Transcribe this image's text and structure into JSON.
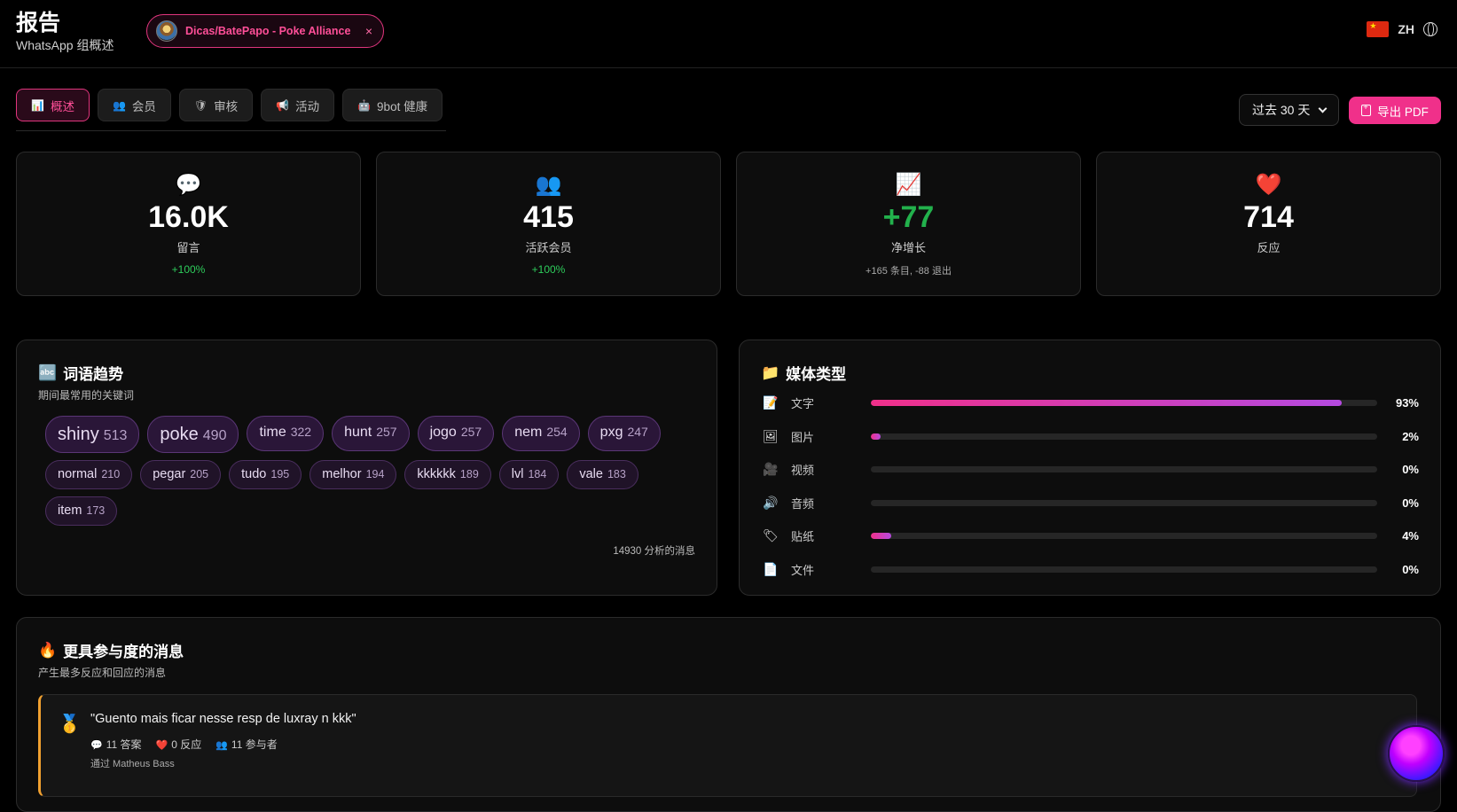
{
  "header": {
    "title": "报告",
    "subtitle": "WhatsApp 组概述",
    "group_name": "Dicas/BatePapo - Poke Alliance",
    "close_glyph": "×",
    "lang_code": "ZH"
  },
  "tabs": [
    {
      "icon": "📊",
      "label": "概述",
      "active": true
    },
    {
      "icon": "👥",
      "label": "会员"
    },
    {
      "icon": "🛡",
      "label": "审核"
    },
    {
      "icon": "📢",
      "label": "活动"
    },
    {
      "icon": "🤖",
      "label": "9bot 健康"
    }
  ],
  "controls": {
    "range": "过去 30 天",
    "export_label": "导出 PDF"
  },
  "stats": [
    {
      "icon": "💬",
      "value": "16.0K",
      "label": "留言",
      "delta": "+100%"
    },
    {
      "icon": "👥",
      "value": "415",
      "label": "活跃会员",
      "delta": "+100%"
    },
    {
      "icon": "📈",
      "value": "+77",
      "label": "净增长",
      "delta": "+165 条目, -88 退出"
    },
    {
      "icon": "❤️",
      "value": "714",
      "label": "反应",
      "delta": ""
    }
  ],
  "words_panel": {
    "icon": "🔤",
    "title": "词语趋势",
    "subtitle": "期间最常用的关键词",
    "words": [
      {
        "word": "shiny",
        "count": "513"
      },
      {
        "word": "poke",
        "count": "490"
      },
      {
        "word": "time",
        "count": "322"
      },
      {
        "word": "hunt",
        "count": "257"
      },
      {
        "word": "jogo",
        "count": "257"
      },
      {
        "word": "nem",
        "count": "254"
      },
      {
        "word": "pxg",
        "count": "247"
      },
      {
        "word": "normal",
        "count": "210"
      },
      {
        "word": "pegar",
        "count": "205"
      },
      {
        "word": "tudo",
        "count": "195"
      },
      {
        "word": "melhor",
        "count": "194"
      },
      {
        "word": "kkkkkk",
        "count": "189"
      },
      {
        "word": "lvl",
        "count": "184"
      },
      {
        "word": "vale",
        "count": "183"
      },
      {
        "word": "item",
        "count": "173"
      }
    ],
    "analyzed": "14930 分析的消息"
  },
  "media_panel": {
    "icon": "📁",
    "title": "媒体类型",
    "rows": [
      {
        "icon": "📝",
        "label": "文字",
        "pct": "93%",
        "value": 93
      },
      {
        "icon": "🖼",
        "label": "图片",
        "pct": "2%",
        "value": 2
      },
      {
        "icon": "🎥",
        "label": "视频",
        "pct": "0%",
        "value": 0
      },
      {
        "icon": "🔊",
        "label": "音频",
        "pct": "0%",
        "value": 0
      },
      {
        "icon": "🏷",
        "label": "贴纸",
        "pct": "4%",
        "value": 4
      },
      {
        "icon": "📄",
        "label": "文件",
        "pct": "0%",
        "value": 0
      }
    ]
  },
  "engaged_panel": {
    "icon": "🔥",
    "title": "更具参与度的消息",
    "subtitle": "产生最多反应和回应的消息",
    "message": {
      "medal": "🥇",
      "text": "\"Guento mais ficar nesse resp de luxray n kkk\"",
      "replies": "11 答案",
      "reactions": "0 反应",
      "participants": "11 参与者",
      "author": "通过 Matheus Bass"
    }
  },
  "colors": {
    "accent": "#f0308a",
    "success": "#22b14c"
  }
}
